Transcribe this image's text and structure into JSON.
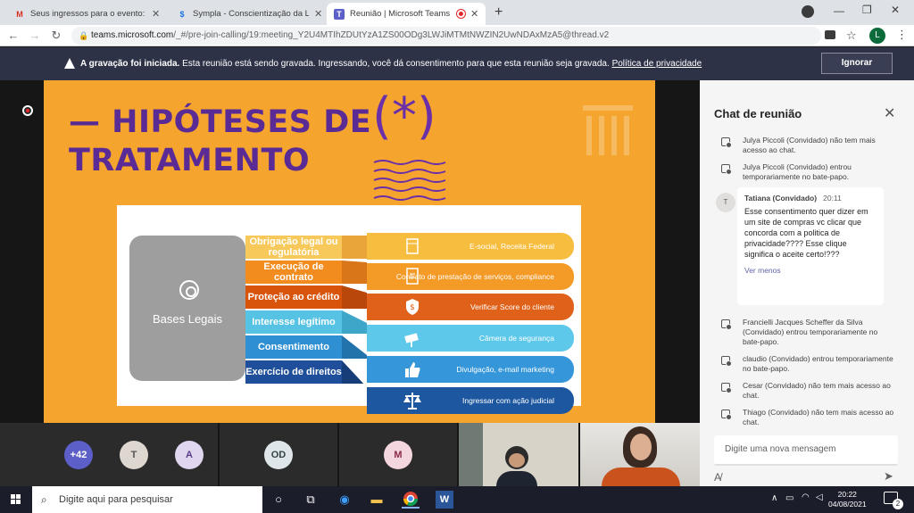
{
  "browser": {
    "tabs": [
      {
        "title": "Seus ingressos para o evento: Co",
        "icon": "gmail-icon"
      },
      {
        "title": "Sympla - Conscientização da LGP",
        "icon": "sympla-icon"
      },
      {
        "title": "Reunião | Microsoft Teams",
        "icon": "teams-icon"
      }
    ],
    "url_domain": "teams.microsoft.com",
    "url_path": "/_#/pre-join-calling/19:meeting_Y2U4MTIhZDUtYzA1ZS00ODg3LWJiMTMtNWZIN2UwNDAxMzA5@thread.v2",
    "profile_initial": "L"
  },
  "banner": {
    "bold": "A gravação foi iniciada.",
    "text": " Esta reunião está sendo gravada. Ingressando, você dá consentimento para que esta reunião seja gravada. ",
    "link": "Política de privacidade",
    "button": "Ignorar"
  },
  "slide": {
    "title": "— HIPÓTESES DE TRATAMENTO",
    "star": "(*)",
    "center_label": "Bases Legais",
    "rows": [
      {
        "left": "Obrigação legal ou regulatória",
        "right": "E-social, Receita Federal",
        "color": "#f7c85a",
        "rightcolor": "#f6bd3f"
      },
      {
        "left": "Execução de contrato",
        "right": "Contrato de prestação de serviços, compliance",
        "color": "#f28c1e",
        "rightcolor": "#f39a27"
      },
      {
        "left": "Proteção ao crédito",
        "right": "Verificar Score do cliente",
        "color": "#d9540b",
        "rightcolor": "#e0621a"
      },
      {
        "left": "Interesse legítimo",
        "right": "Câmera de segurança",
        "color": "#56c2e4",
        "rightcolor": "#5ec8ea"
      },
      {
        "left": "Consentimento",
        "right": "Divulgação, e-mail marketing",
        "color": "#2e8fd2",
        "rightcolor": "#3597d9"
      },
      {
        "left": "Exercício de direitos",
        "right": "Ingressar com ação judicial",
        "color": "#1f4f9a",
        "rightcolor": "#1d579f"
      }
    ]
  },
  "participants": {
    "overflow": "+42",
    "avatars": [
      {
        "initials": "T",
        "bg": "#ddd7d0",
        "fg": "#555"
      },
      {
        "initials": "A",
        "bg": "#e0d6f0",
        "fg": "#5b3d8a"
      },
      {
        "initials": "OD",
        "bg": "#dfe6ea",
        "fg": "#344"
      },
      {
        "initials": "M",
        "bg": "#f4d6de",
        "fg": "#8a2a4a"
      }
    ]
  },
  "chat": {
    "title": "Chat de reunião",
    "system_top": [
      "Julya Piccoli (Convidado) não tem mais acesso ao chat.",
      "Julya Piccoli (Convidado) entrou temporariamente no bate-papo."
    ],
    "message": {
      "avatar": "T",
      "author": "Tatiana (Convidado)",
      "time": "20:11",
      "body": "Esse consentimento quer dizer em um site de compras vc clicar que concorda com a politica de privacidade???? Esse clique significa o aceite certo!???",
      "more": "Ver menos"
    },
    "system_bottom": [
      "Francielli Jacques Scheffer da Silva (Convidado) entrou temporariamente no bate-papo.",
      "claudio (Convidado) entrou temporariamente no bate-papo.",
      "Cesar (Convidado) não tem mais acesso ao chat.",
      "Thiago (Convidado) não tem mais acesso ao chat."
    ],
    "compose_placeholder": "Digite uma nova mensagem"
  },
  "taskbar": {
    "search": "Digite aqui para pesquisar",
    "time": "20:22",
    "date": "04/08/2021",
    "notifications": "2"
  }
}
